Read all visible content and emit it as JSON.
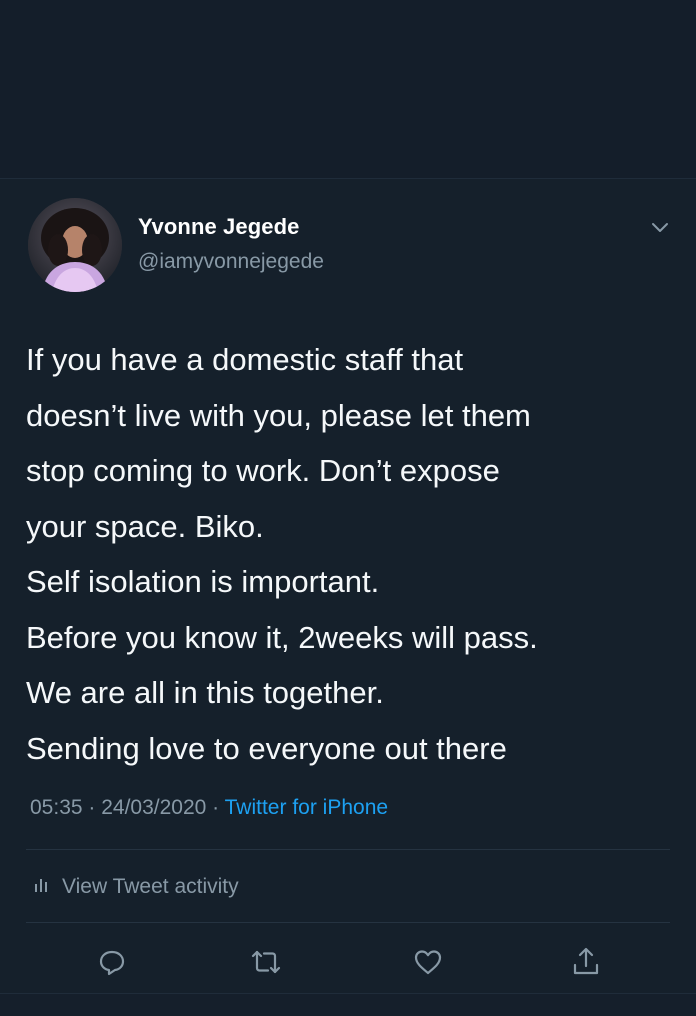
{
  "tweet": {
    "author": {
      "name": "Yvonne Jegede",
      "handle": "@iamyvonnejegede"
    },
    "lines": [
      "If you have a domestic staff that",
      "doesn’t live with you, please let them",
      "stop coming to work. Don’t expose",
      "your space. Biko.",
      "Self isolation is important.",
      "Before you know it, 2weeks will pass.",
      "We are all in this together.",
      "Sending love to everyone out there"
    ],
    "time": "05:35",
    "separator": " · ",
    "date": "24/03/2020",
    "source": "Twitter for iPhone",
    "activity_label": "View Tweet activity"
  },
  "icons": {
    "menu": "chevron-down-icon",
    "activity": "bar-chart-icon",
    "reply": "reply-icon",
    "retweet": "retweet-icon",
    "like": "heart-icon",
    "share": "share-icon"
  },
  "colors": {
    "background": "#15202b",
    "text_primary": "#f5f8fa",
    "text_secondary": "#8899a6",
    "accent": "#1da1f2",
    "divider": "#253341"
  }
}
